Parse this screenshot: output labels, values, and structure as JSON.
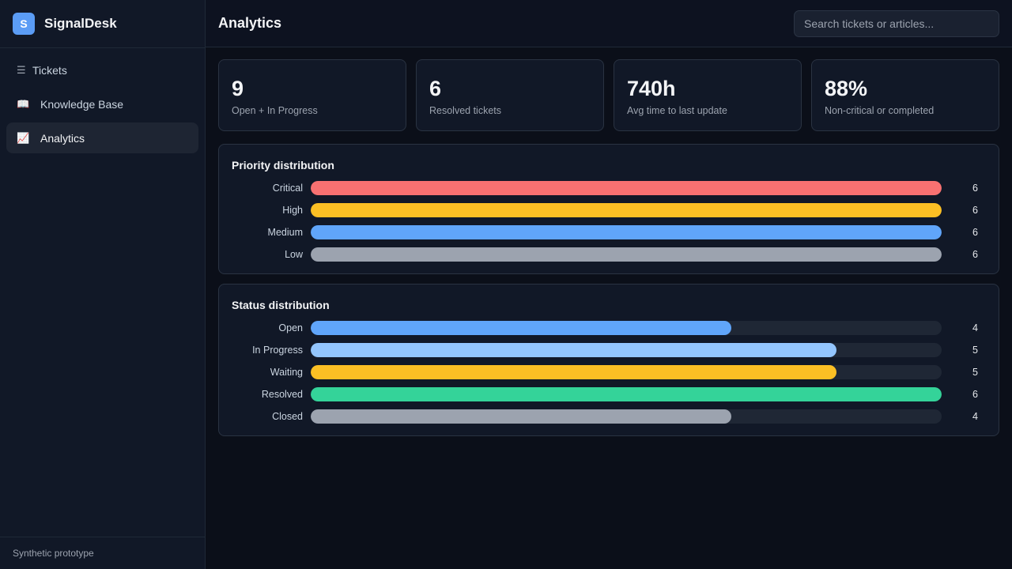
{
  "app": {
    "logo_letter": "S",
    "name": "SignalDesk"
  },
  "sidebar": {
    "items": [
      {
        "label": "Tickets",
        "icon": "list-icon",
        "active": false
      },
      {
        "label": "Knowledge Base",
        "icon": "book-icon",
        "active": false
      },
      {
        "label": "Analytics",
        "icon": "chart-icon",
        "active": true
      }
    ],
    "footer": "Synthetic prototype"
  },
  "header": {
    "title": "Analytics",
    "search_placeholder": "Search tickets or articles..."
  },
  "kpis": [
    {
      "value": "9",
      "label": "Open + In Progress"
    },
    {
      "value": "6",
      "label": "Resolved tickets"
    },
    {
      "value": "740h",
      "label": "Avg time to last update"
    },
    {
      "value": "88%",
      "label": "Non-critical or completed"
    }
  ],
  "priority": {
    "title": "Priority distribution",
    "max": 6,
    "rows": [
      {
        "label": "Critical",
        "value": 6,
        "color": "#f87171"
      },
      {
        "label": "High",
        "value": 6,
        "color": "#fbbf24"
      },
      {
        "label": "Medium",
        "value": 6,
        "color": "#60a5fa"
      },
      {
        "label": "Low",
        "value": 6,
        "color": "#9ca3af"
      }
    ]
  },
  "status": {
    "title": "Status distribution",
    "max": 6,
    "rows": [
      {
        "label": "Open",
        "value": 4,
        "color": "#60a5fa"
      },
      {
        "label": "In Progress",
        "value": 5,
        "color": "#93c5fd"
      },
      {
        "label": "Waiting",
        "value": 5,
        "color": "#fbbf24"
      },
      {
        "label": "Resolved",
        "value": 6,
        "color": "#34d399"
      },
      {
        "label": "Closed",
        "value": 4,
        "color": "#9ca3af"
      }
    ]
  }
}
